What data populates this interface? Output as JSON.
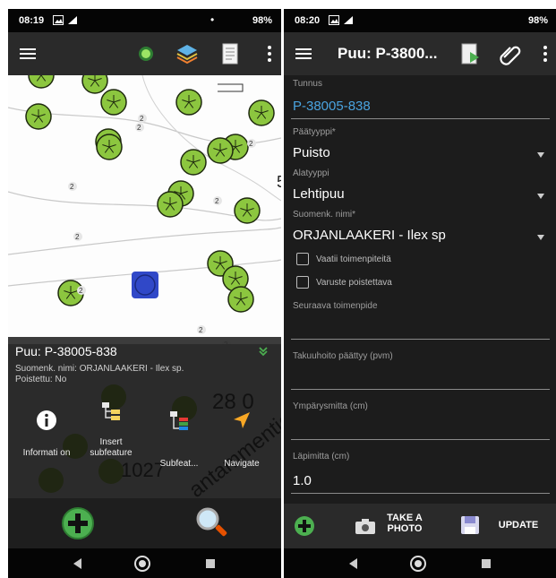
{
  "left": {
    "status": {
      "time": "08:19",
      "battery": "98%"
    },
    "map": {
      "text_5": "5",
      "text_28_0": "28 0",
      "text_1027": "1027",
      "text_street": "antammentie",
      "label_2": "2"
    },
    "panel": {
      "title": "Puu: P-38005-838",
      "line1": "Suomenk. nimi: ORJANLAAKERI - Ilex sp.",
      "line2": "Poistettu: No",
      "actions": {
        "info": "Informati on",
        "insert": "Insert subfeature",
        "subfeat": "Subfeat...",
        "navigate": "Navigate"
      }
    },
    "icons": {
      "menu": "hamburger-icon",
      "gps": "gps-icon",
      "layers": "layers-icon",
      "notes": "notes-icon",
      "more": "more-vert-icon"
    }
  },
  "right": {
    "status": {
      "time": "08:20",
      "battery": "98%"
    },
    "appbar": {
      "title": "Puu: P-3800..."
    },
    "form": {
      "tunnus_label": "Tunnus",
      "tunnus_value": "P-38005-838",
      "paatyyppi_label": "Päätyyppi*",
      "paatyyppi_value": "Puisto",
      "alatyyppi_label": "Alatyyppi",
      "alatyyppi_value": "Lehtipuu",
      "nimi_label": "Suomenk. nimi*",
      "nimi_value": "ORJANLAAKERI - Ilex sp",
      "cb1_label": "Vaatii toimenpiteitä",
      "cb2_label": "Varuste poistettava",
      "seuraava_label": "Seuraava toimenpide",
      "takuu_label": "Takuuhoito päättyy (pvm)",
      "ympary_label": "Ympärysmitta (cm)",
      "lapimitta_label": "Läpimitta (cm)",
      "lapimitta_value": "1.0"
    },
    "bottom": {
      "take_photo": "TAKE A PHOTO",
      "update": "UPDATE"
    }
  },
  "colors": {
    "tree_fill": "#8cc63f",
    "tree_stroke": "#1f2a0f",
    "selection": "#3048c8",
    "link": "#4aa3df",
    "accent_green": "#4caf50"
  }
}
